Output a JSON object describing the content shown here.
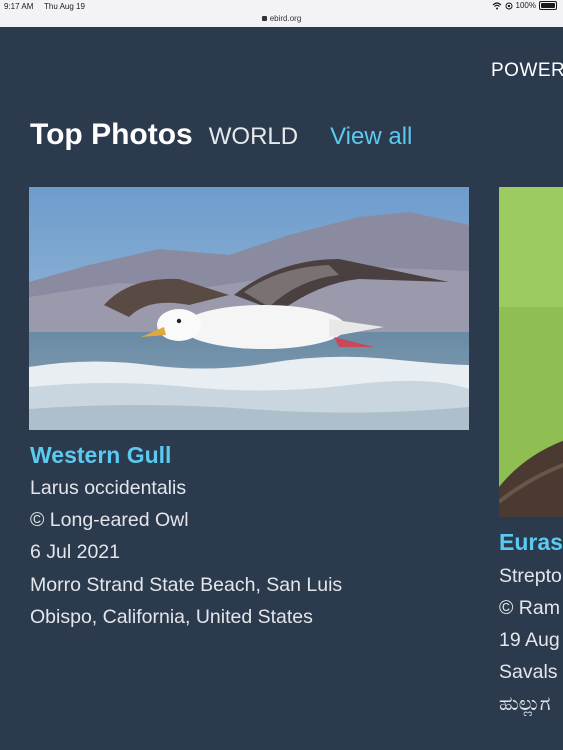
{
  "status_bar": {
    "time": "9:17 AM",
    "date": "Thu Aug 19",
    "battery": "100%",
    "url": "ebird.org"
  },
  "header": {
    "powered_text": "POWER"
  },
  "section": {
    "title": "Top Photos",
    "scope": "WORLD",
    "view_all": "View all"
  },
  "cards": [
    {
      "common_name": "Western Gull",
      "scientific_name": "Larus occidentalis",
      "credit": "© Long-eared Owl",
      "date": "6 Jul 2021",
      "location_line1": "Morro Strand State Beach, San Luis",
      "location_line2": "Obispo, California, United States"
    },
    {
      "common_name": "Euras",
      "scientific_name": "Strepto",
      "credit": "© Ram",
      "date": "19 Aug",
      "location_line1": "Savals",
      "location_line2": "ಹುಲ್ಲುಗ"
    }
  ],
  "icons": [
    "wifi-icon",
    "lock-icon",
    "battery-icon"
  ]
}
